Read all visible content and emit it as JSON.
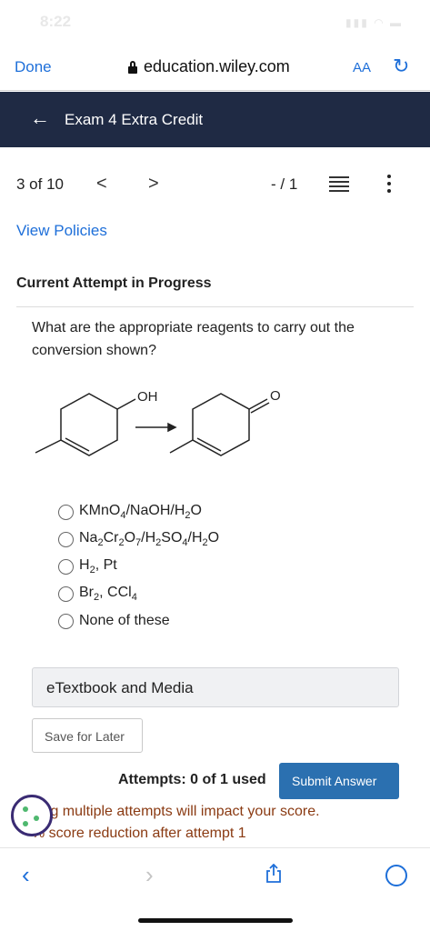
{
  "status_bar": {
    "time": "8:22"
  },
  "browser": {
    "done_label": "Done",
    "url": "education.wiley.com",
    "text_size_label": "AA"
  },
  "header": {
    "title": "Exam 4 Extra Credit"
  },
  "nav": {
    "question_count": "3 of 10",
    "prev": "<",
    "next": ">",
    "score": "- / 1"
  },
  "content": {
    "policies_link": "View Policies",
    "attempt_heading": "Current Attempt in Progress",
    "question": "What are the appropriate reagents to carry out the conversion shown?",
    "molecule": {
      "reactant_label": "OH",
      "product_label": "O"
    },
    "options": [
      {
        "main": "KMnO",
        "sub1": "4",
        "rest": "/NaOH/H",
        "sub2": "2",
        "end": "O"
      },
      {
        "main": "Na",
        "sub1": "2",
        "rest": "Cr",
        "sub2": "2",
        "end": "O7/H2SO4/H2O"
      },
      {
        "main": "H",
        "sub1": "2",
        "rest": ", Pt",
        "sub2": "",
        "end": ""
      },
      {
        "main": "Br",
        "sub1": "2",
        "rest": ", CCl",
        "sub2": "4",
        "end": ""
      },
      {
        "main": "None of these",
        "sub1": "",
        "rest": "",
        "sub2": "",
        "end": ""
      }
    ],
    "etextbook_label": "eTextbook and Media",
    "save_label": "Save for Later",
    "attempts_text": "Attempts: 0 of 1 used",
    "submit_label": "Submit Answer",
    "warning_line1": "sing multiple attempts will impact your score.",
    "warning_line2": "% score reduction after attempt 1"
  },
  "icons": {
    "lock": "lock-icon",
    "reload": "reload-icon",
    "back_arrow": "arrow-left-icon",
    "list": "list-icon",
    "more": "more-vertical-icon",
    "cookie": "cookie-icon",
    "share": "share-icon",
    "compass": "compass-icon"
  },
  "colors": {
    "header_bg": "#1f2a44",
    "link": "#1e6fd9",
    "submit_bg": "#2b70b0",
    "warning": "#8a3a12"
  }
}
